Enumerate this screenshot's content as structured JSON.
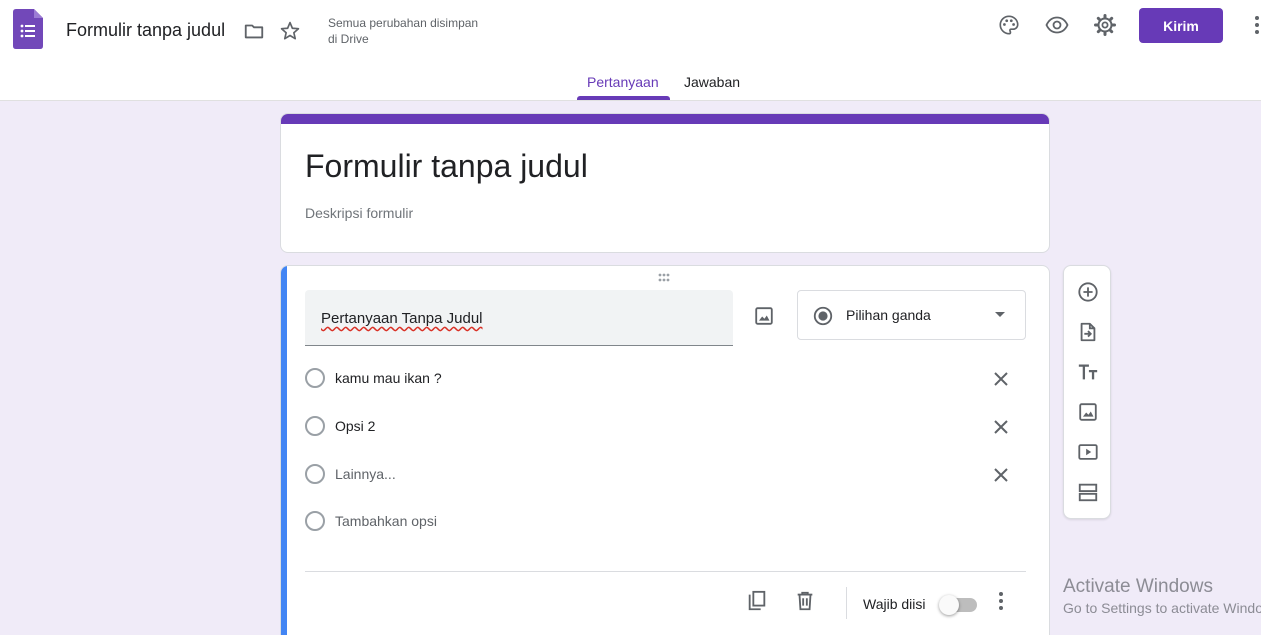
{
  "header": {
    "doc_title": "Formulir tanpa judul",
    "save_status_line1": "Semua perubahan disimpan",
    "save_status_line2": "di Drive",
    "send_label": "Kirim"
  },
  "tabs": [
    {
      "label": "Pertanyaan",
      "active": true
    },
    {
      "label": "Jawaban",
      "active": false
    }
  ],
  "form": {
    "title": "Formulir tanpa judul",
    "description_placeholder": "Deskripsi formulir"
  },
  "question": {
    "title": "Pertanyaan Tanpa Judul",
    "type": "Pilihan ganda",
    "options": [
      {
        "label": "kamu mau ikan ?"
      },
      {
        "label": "Opsi 2"
      },
      {
        "label": "Lainnya..."
      }
    ],
    "add_option_label": "Tambahkan opsi",
    "required_label": "Wajib diisi",
    "required": false
  },
  "watermark": {
    "line1": "Activate Windows",
    "line2": "Go to Settings to activate Windows."
  },
  "colors": {
    "accent": "#673ab7",
    "background": "#f0ebf8",
    "active_question_bar": "#4285f4"
  }
}
